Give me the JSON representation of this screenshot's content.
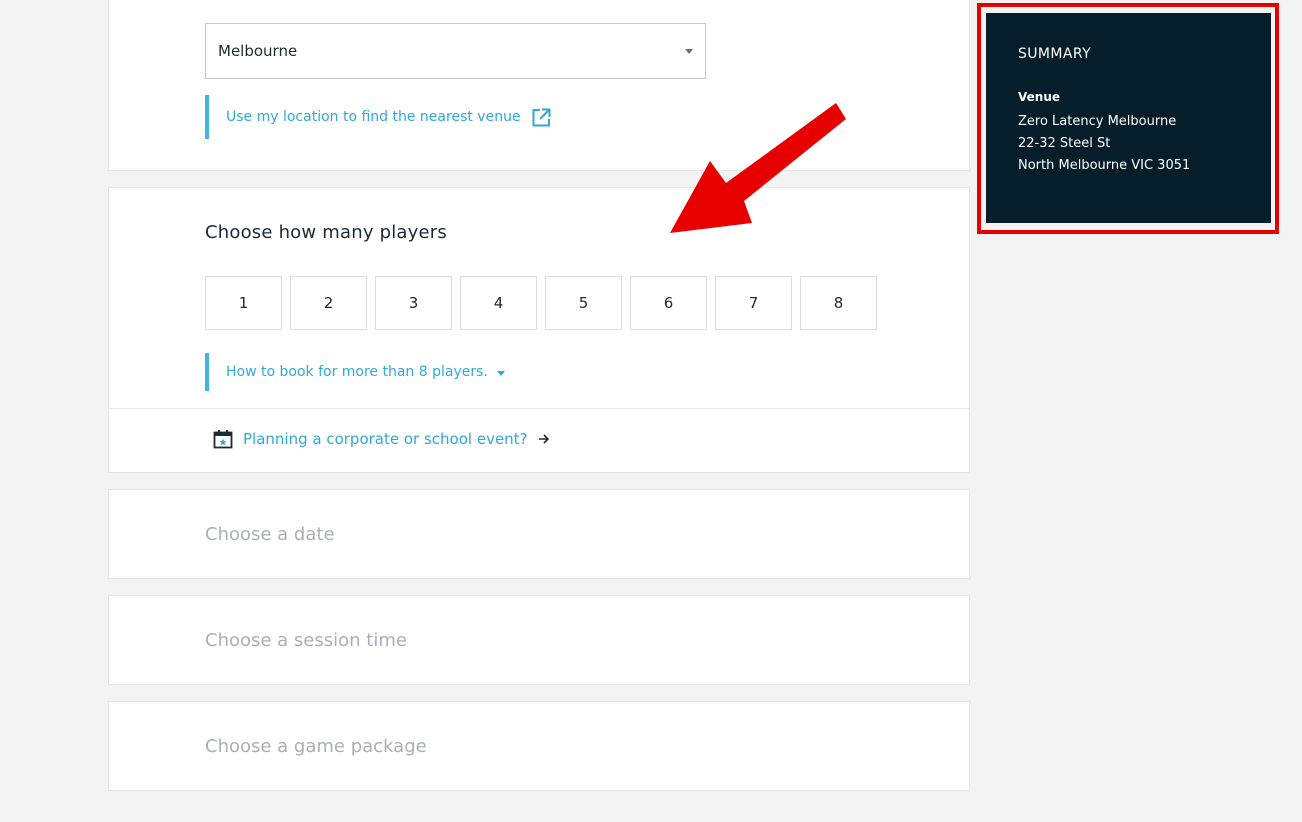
{
  "venue_section": {
    "selected_city": "Melbourne",
    "location_link": "Use my location to find the nearest venue"
  },
  "players_section": {
    "title": "Choose how many players",
    "options": [
      "1",
      "2",
      "3",
      "4",
      "5",
      "6",
      "7",
      "8"
    ],
    "more_link": "How to book for more than 8 players.",
    "corporate_link": "Planning a corporate or school event?"
  },
  "date_section": {
    "title": "Choose a date"
  },
  "session_section": {
    "title": "Choose a session time"
  },
  "package_section": {
    "title": "Choose a game package"
  },
  "summary": {
    "heading": "SUMMARY",
    "venue_label": "Venue",
    "venue_name": "Zero Latency Melbourne",
    "address_line1": "22-32 Steel St",
    "address_line2": "North Melbourne VIC 3051"
  },
  "colors": {
    "accent": "#2fa9d6",
    "summary_bg": "#061e2a",
    "annotation_red": "#e60000"
  },
  "icons": [
    "external-link-icon",
    "caret-down-icon",
    "calendar-icon",
    "arrow-right-icon"
  ]
}
